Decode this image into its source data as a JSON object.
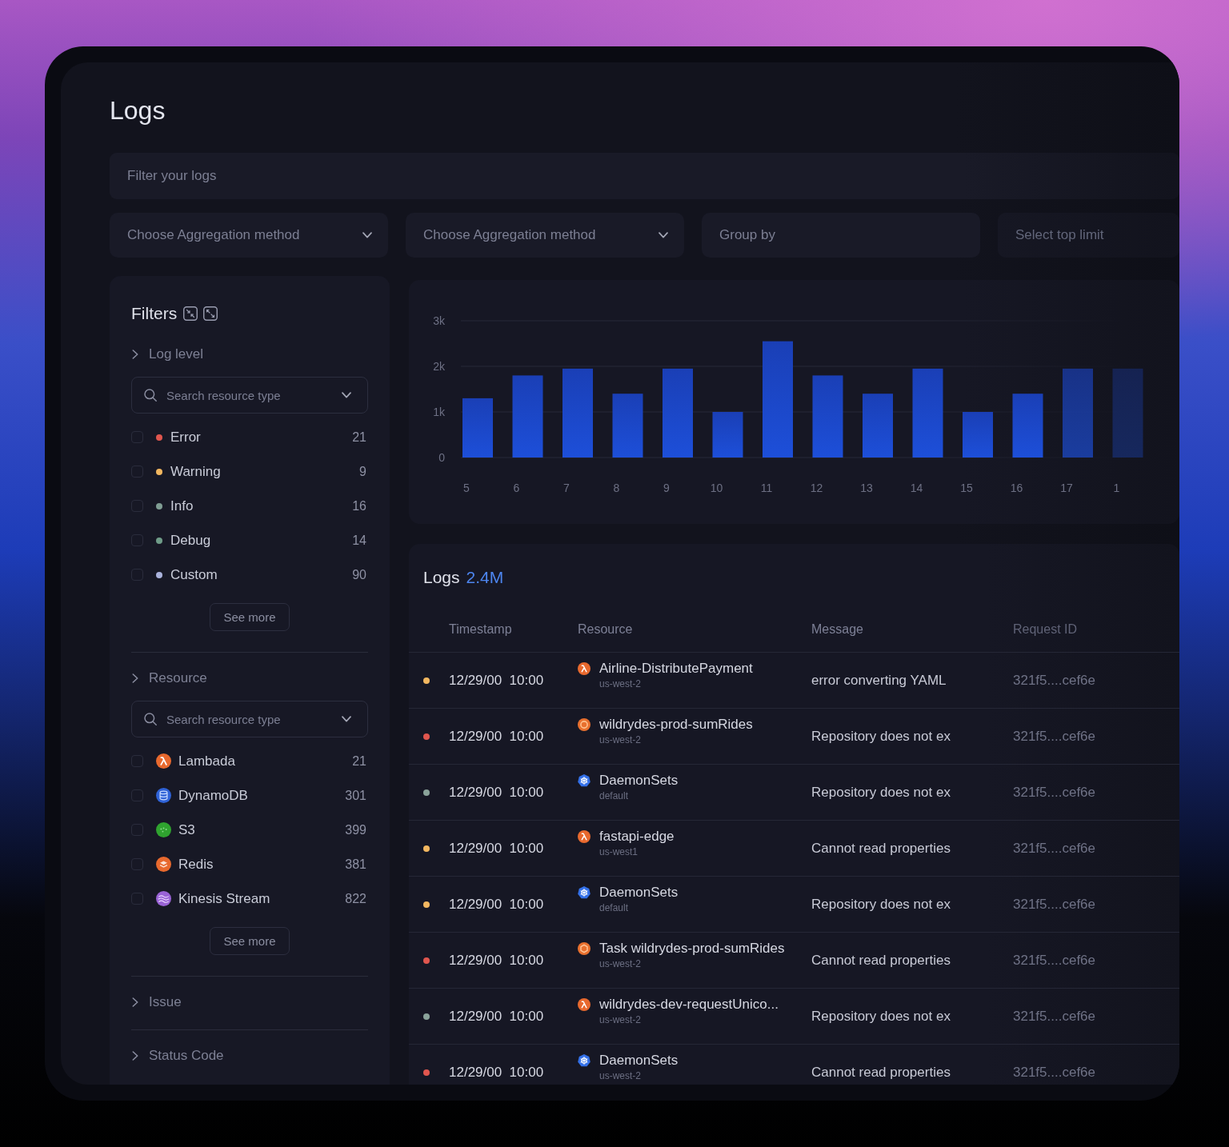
{
  "page": {
    "title": "Logs"
  },
  "filter_field": {
    "placeholder": "Filter your logs"
  },
  "controls": [
    {
      "kind": "select",
      "placeholder": "Choose Aggregation method"
    },
    {
      "kind": "select",
      "placeholder": "Choose Aggregation method"
    },
    {
      "kind": "input",
      "placeholder": "Group by"
    },
    {
      "kind": "input",
      "placeholder": "Select top limit"
    }
  ],
  "filters": {
    "title": "Filters",
    "sections": [
      {
        "title": "Log level",
        "search": {
          "placeholder": "Search resource type"
        },
        "items": [
          {
            "kind": "dot",
            "label": "Error",
            "count": "21",
            "checked": false,
            "color": "#e0564e"
          },
          {
            "kind": "dot",
            "label": "Warning",
            "count": "9",
            "checked": false,
            "color": "#f2b760"
          },
          {
            "kind": "dot",
            "label": "Info",
            "count": "16",
            "checked": false,
            "color": "#7f9d93"
          },
          {
            "kind": "dot",
            "label": "Debug",
            "count": "14",
            "checked": false,
            "color": "#6f9c88"
          },
          {
            "kind": "dot",
            "label": "Custom",
            "count": "90",
            "checked": false,
            "color": "#aab3dc"
          }
        ],
        "more_button": "See more"
      },
      {
        "title": "Resource",
        "search": {
          "placeholder": "Search resource type"
        },
        "items": [
          {
            "kind": "lambda",
            "label": "Lambada",
            "count": "21",
            "checked": false
          },
          {
            "kind": "cylinder",
            "label": "DynamoDB",
            "count": "301",
            "checked": false
          },
          {
            "kind": "disc",
            "label": "S3",
            "count": "399",
            "checked": false
          },
          {
            "kind": "cubes",
            "label": "Redis",
            "count": "381",
            "checked": false
          },
          {
            "kind": "waves",
            "label": "Kinesis Stream",
            "count": "822",
            "checked": false
          }
        ],
        "more_button": "See more"
      },
      {
        "title": "Issue"
      },
      {
        "title": "Status Code"
      }
    ]
  },
  "chart": {
    "chart_data": {
      "type": "bar",
      "categories": [
        "5",
        "6",
        "7",
        "8",
        "9",
        "10",
        "11",
        "12",
        "13",
        "14",
        "15",
        "16",
        "17",
        "1"
      ],
      "values": [
        1300,
        1800,
        1950,
        1400,
        1950,
        1000,
        2550,
        1800,
        1400,
        1950,
        1000,
        1400,
        1950,
        1950
      ],
      "ylim": [
        0,
        3000
      ],
      "yticks": [
        {
          "value": 0,
          "label": "0"
        },
        {
          "value": 1000,
          "label": "1k"
        },
        {
          "value": 2000,
          "label": "2k"
        },
        {
          "value": 3000,
          "label": "3k"
        }
      ]
    }
  },
  "logs": {
    "title": "Logs",
    "count": "2.4M",
    "columns": [
      "Timestamp",
      "Resource",
      "Message",
      "Request ID"
    ],
    "rows": [
      {
        "color": "#f2b760",
        "timestamp": "12/29/00  10:00",
        "kind": "lambda",
        "resource": "Airline-DistributePayment",
        "region": "us-west-2",
        "message": "error converting YAML",
        "request_id": "321f5....cef6e"
      },
      {
        "color": "#e0564e",
        "timestamp": "12/29/00  10:00",
        "kind": "ring",
        "resource": "wildrydes-prod-sumRides",
        "region": "us-west-2",
        "message": "Repository does not ex",
        "request_id": "321f5....cef6e"
      },
      {
        "color": "#8aa39a",
        "timestamp": "12/29/00  10:00",
        "kind": "wheel",
        "resource": "DaemonSets",
        "region": "default",
        "message": "Repository does not ex",
        "request_id": "321f5....cef6e"
      },
      {
        "color": "#f2b760",
        "timestamp": "12/29/00  10:00",
        "kind": "lambda",
        "resource": "fastapi-edge",
        "region": "us-west1",
        "message": "Cannot read properties",
        "request_id": "321f5....cef6e"
      },
      {
        "color": "#f2b760",
        "timestamp": "12/29/00  10:00",
        "kind": "wheel",
        "resource": "DaemonSets",
        "region": "default",
        "message": "Repository does not ex",
        "request_id": "321f5....cef6e"
      },
      {
        "color": "#e0564e",
        "timestamp": "12/29/00  10:00",
        "kind": "hexagon",
        "resource": "Task wildrydes-prod-sumRides",
        "region": "us-west-2",
        "message": "Cannot read properties",
        "request_id": "321f5....cef6e"
      },
      {
        "color": "#8aa39a",
        "timestamp": "12/29/00  10:00",
        "kind": "lambda",
        "resource": "wildrydes-dev-requestUnico...",
        "region": "us-west-2",
        "message": "Repository does not ex",
        "request_id": "321f5....cef6e"
      },
      {
        "color": "#e0564e",
        "timestamp": "12/29/00  10:00",
        "kind": "wheel",
        "resource": "DaemonSets",
        "region": "us-west-2",
        "message": "Cannot read properties",
        "request_id": "321f5....cef6e"
      }
    ]
  }
}
